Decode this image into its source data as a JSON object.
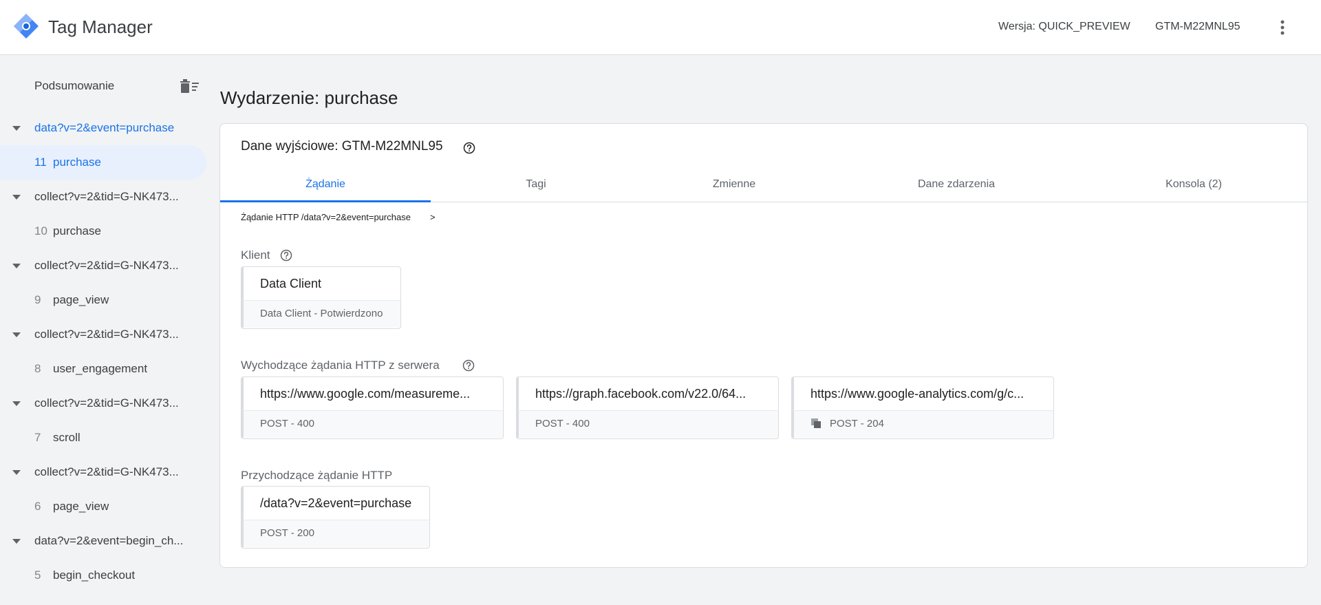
{
  "header": {
    "title": "Tag Manager",
    "version": "Wersja: QUICK_PREVIEW",
    "container_id": "GTM-M22MNL95"
  },
  "sidebar": {
    "summary_label": "Podsumowanie",
    "groups": [
      {
        "label": "data?v=2&event=purchase",
        "item_num": "11",
        "item_label": "purchase"
      },
      {
        "label": "collect?v=2&tid=G-NK473...",
        "item_num": "10",
        "item_label": "purchase"
      },
      {
        "label": "collect?v=2&tid=G-NK473...",
        "item_num": "9",
        "item_label": "page_view"
      },
      {
        "label": "collect?v=2&tid=G-NK473...",
        "item_num": "8",
        "item_label": "user_engagement"
      },
      {
        "label": "collect?v=2&tid=G-NK473...",
        "item_num": "7",
        "item_label": "scroll"
      },
      {
        "label": "collect?v=2&tid=G-NK473...",
        "item_num": "6",
        "item_label": "page_view"
      },
      {
        "label": "data?v=2&event=begin_ch...",
        "item_num": "5",
        "item_label": "begin_checkout"
      }
    ]
  },
  "main": {
    "page_title": "Wydarzenie: purchase",
    "card_title": "Dane wyjściowe: GTM-M22MNL95",
    "tabs": [
      "Żądanie",
      "Tagi",
      "Zmienne",
      "Dane zdarzenia",
      "Konsola (2)"
    ],
    "breadcrumb": "Żądanie HTTP /data?v=2&event=purchase",
    "breadcrumb_chevron": ">",
    "client_section": {
      "label": "Klient",
      "chip": {
        "title": "Data Client",
        "subtitle": "Data Client - Potwierdzono"
      }
    },
    "outgoing_section": {
      "label": "Wychodzące żądania HTTP z serwera",
      "chips": [
        {
          "title": "https://www.google.com/measureme...",
          "subtitle": "POST - 400"
        },
        {
          "title": "https://graph.facebook.com/v22.0/64...",
          "subtitle": "POST - 400"
        },
        {
          "title": "https://www.google-analytics.com/g/c...",
          "subtitle": "POST - 204"
        }
      ]
    },
    "incoming_section": {
      "label": "Przychodzące żądanie HTTP",
      "chip": {
        "title": "/data?v=2&event=purchase",
        "subtitle": "POST - 200"
      }
    }
  },
  "colors": {
    "accent": "#1a73e8",
    "selected_bg": "#e8f0fe",
    "page_bg": "#f1f3f4"
  }
}
